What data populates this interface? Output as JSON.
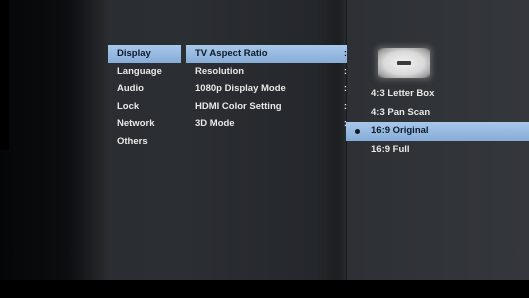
{
  "menu": {
    "items": [
      {
        "label": "Display"
      },
      {
        "label": "Language"
      },
      {
        "label": "Audio"
      },
      {
        "label": "Lock"
      },
      {
        "label": "Network"
      },
      {
        "label": "Others"
      }
    ]
  },
  "submenu": {
    "items": [
      {
        "label": "TV Aspect Ratio",
        "sep": ":"
      },
      {
        "label": "Resolution",
        "sep": ":"
      },
      {
        "label": "1080p Display Mode",
        "sep": ":"
      },
      {
        "label": "HDMI Color Setting",
        "sep": ":"
      },
      {
        "label": "3D Mode",
        "sep": ":"
      }
    ]
  },
  "options": {
    "items": [
      {
        "label": "4:3 Letter Box"
      },
      {
        "label": "4:3 Pan Scan"
      },
      {
        "label": "16:9 Original"
      },
      {
        "label": "16:9 Full"
      }
    ]
  },
  "colors": {
    "highlight": "#9dbde2",
    "text": "#e8e8e8",
    "highlight_text": "#0d1a2c"
  },
  "icons": {
    "preview": "aspect-ratio-preview-icon",
    "selected": "selected-dot-icon"
  }
}
